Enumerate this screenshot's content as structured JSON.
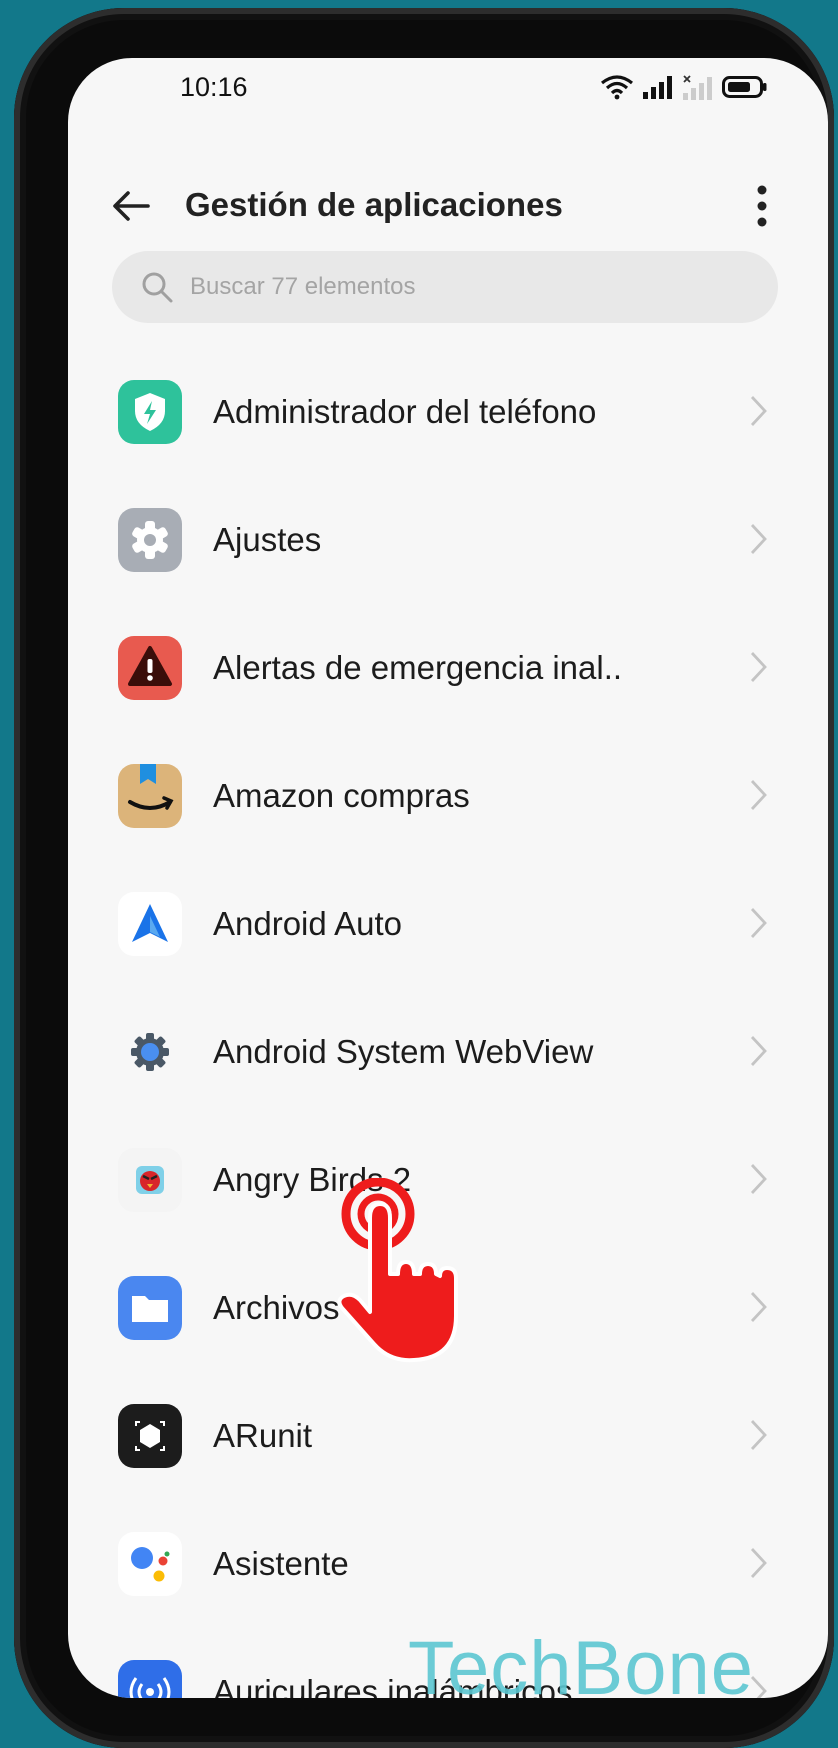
{
  "status_bar": {
    "time": "10:16"
  },
  "header": {
    "title": "Gestión de aplicaciones",
    "back_icon": "arrow-left-icon",
    "more_icon": "more-vertical-icon"
  },
  "search": {
    "placeholder": "Buscar 77 elementos",
    "value": ""
  },
  "apps": [
    {
      "label": "Administrador del teléfono",
      "icon": "phone-manager-icon"
    },
    {
      "label": "Ajustes",
      "icon": "settings-gear-icon"
    },
    {
      "label": "Alertas de emergencia inal..",
      "icon": "emergency-alert-icon"
    },
    {
      "label": "Amazon compras",
      "icon": "amazon-shopping-icon"
    },
    {
      "label": "Android Auto",
      "icon": "android-auto-icon"
    },
    {
      "label": "Android System WebView",
      "icon": "webview-gear-icon"
    },
    {
      "label": "Angry Birds 2",
      "icon": "angry-birds-icon"
    },
    {
      "label": "Archivos",
      "icon": "folder-icon"
    },
    {
      "label": "ARunit",
      "icon": "arunit-icon"
    },
    {
      "label": "Asistente",
      "icon": "google-assistant-icon"
    },
    {
      "label": "Auriculares inalámbricos",
      "icon": "wireless-earphones-icon"
    }
  ],
  "watermark": "TechBone",
  "colors": {
    "background": "#12788a",
    "screen": "#f7f7f7",
    "tap_indicator": "#ee1c1c",
    "watermark": "#5cc7d2"
  }
}
